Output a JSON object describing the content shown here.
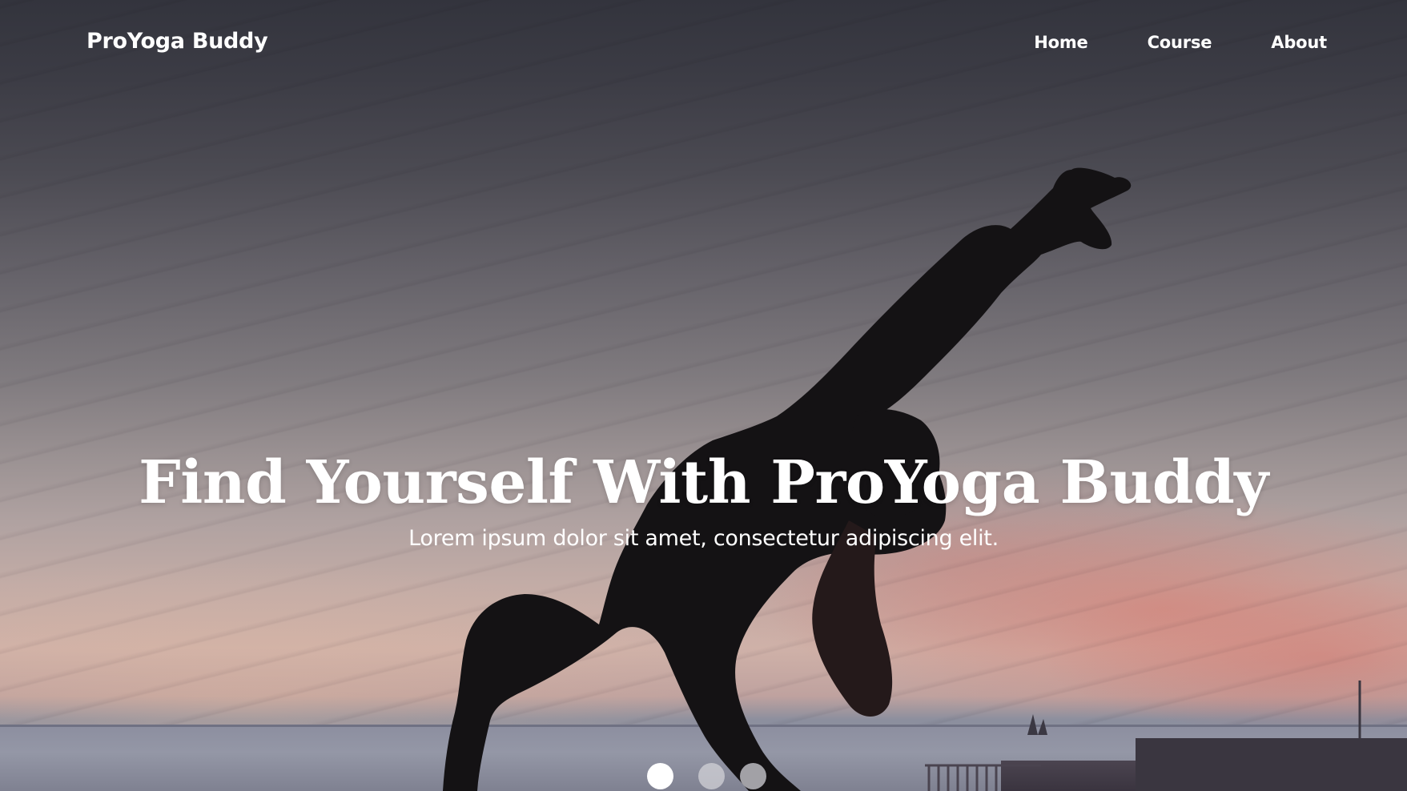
{
  "navbar": {
    "brand": "ProYoga Buddy",
    "links": [
      {
        "label": "Home"
      },
      {
        "label": "Course"
      },
      {
        "label": "About"
      }
    ]
  },
  "hero": {
    "title": "Find Yourself With ProYoga Buddy",
    "subtitle": "Lorem ipsum dolor sit amet, consectetur adipiscing elit.",
    "slides_total": 3,
    "active_slide": 1
  },
  "colors": {
    "text": "#ffffff",
    "dot_active": "#ffffff",
    "dot_inactive": "#c9c9ce"
  }
}
